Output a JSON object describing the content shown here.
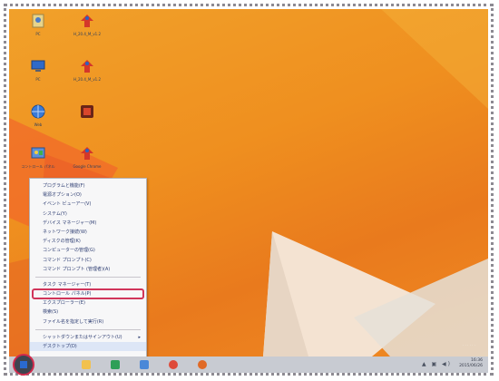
{
  "desktop": {
    "icons": [
      {
        "label": "PC",
        "icon": "user-folder-icon"
      },
      {
        "label": "H_20.4_M_v1.2",
        "icon": "installer-icon"
      },
      {
        "label": "PC",
        "icon": "computer-icon"
      },
      {
        "label": "H_20.4_M_v1.2",
        "icon": "installer-icon"
      },
      {
        "label": "Web",
        "icon": "globe-icon"
      },
      {
        "label": "",
        "icon": "app-icon"
      },
      {
        "label": "コントロール パネル",
        "icon": "control-panel-icon"
      },
      {
        "label": "Google Chrome",
        "icon": "installer-icon"
      }
    ],
    "colors": {
      "accent": "#ef8f1f",
      "highlight": "#d1355a"
    }
  },
  "menu": {
    "items": [
      "プログラムと機能(F)",
      "電源オプション(O)",
      "イベント ビューアー(V)",
      "システム(Y)",
      "デバイス マネージャー(M)",
      "ネットワーク接続(W)",
      "ディスクの管理(K)",
      "コンピューターの管理(G)",
      "コマンド プロンプト(C)",
      "コマンド プロンプト (管理者)(A)",
      "タスク マネージャー(T)",
      "コントロール パネル(P)",
      "エクスプローラー(E)",
      "検索(S)",
      "ファイル名を指定して実行(R)",
      "シャットダウンまたはサインアウト(U)",
      "デスクトップ(D)"
    ],
    "submenu_arrow": "▸"
  },
  "taskbar": {
    "time": "16:36",
    "date": "2015/06/26",
    "tray_icons": "▲ ▣ ◀)"
  }
}
